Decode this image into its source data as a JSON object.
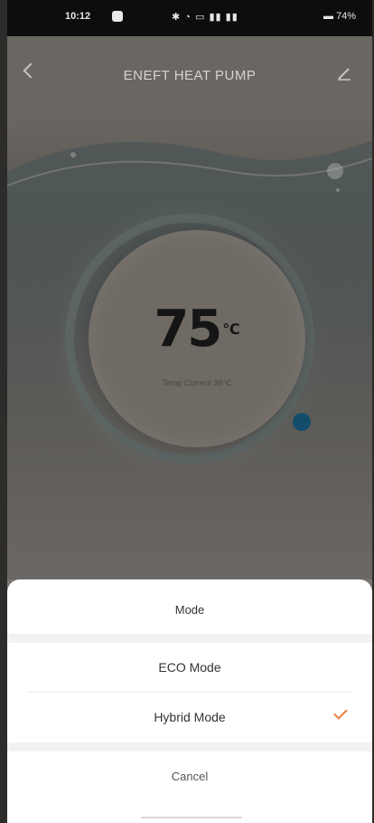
{
  "statusbar": {
    "time": "10:12",
    "battery": "74%",
    "icons": [
      "notification-icon",
      "bluetooth-icon",
      "speed-icon",
      "wifi-icon",
      "cast-icon",
      "signal-icon",
      "signal-icon",
      "battery-icon"
    ]
  },
  "header": {
    "title": "ENEFT HEAT PUMP"
  },
  "dial": {
    "temperature": "75",
    "unit": "℃",
    "subtitle": "Temp Current 38℃"
  },
  "sheet": {
    "title": "Mode",
    "options": [
      {
        "label": "ECO Mode",
        "selected": false
      },
      {
        "label": "Hybrid Mode",
        "selected": true
      }
    ],
    "cancel": "Cancel"
  },
  "colors": {
    "accent": "#ef7a42",
    "handle": "#124e6b"
  }
}
